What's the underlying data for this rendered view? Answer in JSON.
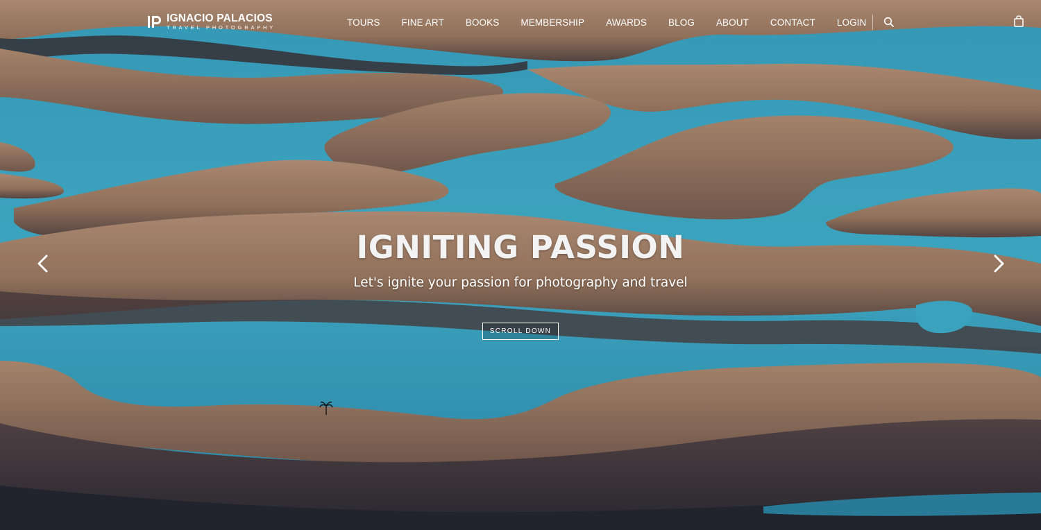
{
  "brand": {
    "name": "IGNACIO PALACIOS",
    "tagline": "TRAVEL PHOTOGRAPHY",
    "mark_icon": "ip-monogram-logo"
  },
  "nav": {
    "items": [
      {
        "label": "TOURS"
      },
      {
        "label": "FINE ART"
      },
      {
        "label": "BOOKS"
      },
      {
        "label": "MEMBERSHIP"
      },
      {
        "label": "AWARDS"
      },
      {
        "label": "BLOG"
      },
      {
        "label": "ABOUT"
      },
      {
        "label": "CONTACT"
      },
      {
        "label": "LOGIN"
      }
    ],
    "search_icon": "search-icon",
    "cart_icon": "shopping-bag-icon"
  },
  "hero": {
    "title": "IGNITING PASSION",
    "subtitle": "Let's ignite your passion for photography and travel",
    "cta_label": "SCROLL DOWN",
    "prev_icon": "chevron-left-icon",
    "next_icon": "chevron-right-icon",
    "image_subject": "aerial view of sand dunes and turquoise lagoons"
  },
  "colors": {
    "sand": "#a9876a",
    "lagoon": "#38a8c8",
    "shadow": "#3a3a44",
    "text": "#ffffff"
  }
}
